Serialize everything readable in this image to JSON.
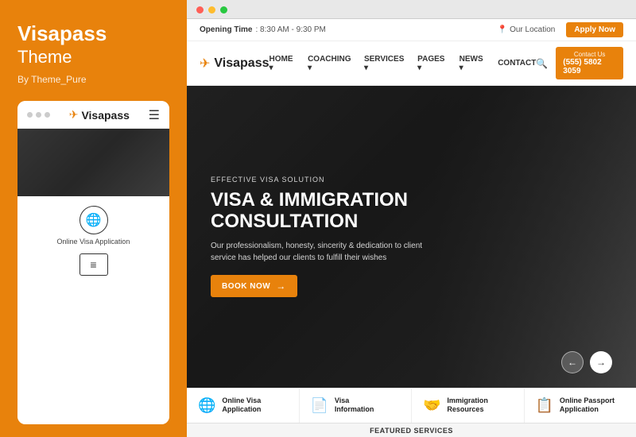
{
  "leftPanel": {
    "brandTitle": "Visapass",
    "brandSubtitle": "Theme",
    "brandAuthor": "By Theme_Pure",
    "mobile": {
      "logoText": "Visapass",
      "bottomIcons": [
        {
          "label": "Online Visa Application",
          "type": "globe"
        },
        {
          "label": "",
          "type": "doc"
        }
      ]
    }
  },
  "rightPanel": {
    "browser": {
      "dots": [
        "red",
        "yellow",
        "green"
      ]
    },
    "topbar": {
      "openingLabel": "Opening Time",
      "openingTime": ": 8:30 AM - 9:30 PM",
      "locationText": "Our Location",
      "applyBtnLabel": "Apply Now"
    },
    "nav": {
      "logoText": "Visapass",
      "links": [
        "HOME",
        "COACHING",
        "SERVICES",
        "PAGES",
        "NEWS",
        "CONTACT"
      ],
      "contactLabel": "Contact Us",
      "contactPhone": "(555) 5802 3059"
    },
    "hero": {
      "eyebrow": "EFFECTIVE VISA SOLUTION",
      "title": "VISA & IMMIGRATION CONSULTATION",
      "description": "Our professionalism, honesty, sincerity & dedication to client service has helped our clients to fulfill their wishes",
      "bookBtnLabel": "BOOK NOW",
      "arrows": [
        "←",
        "→"
      ]
    },
    "servicesBar": [
      {
        "icon": "🌐",
        "name": "Online Visa\nApplication"
      },
      {
        "icon": "📄",
        "name": "Visa\nInformation"
      },
      {
        "icon": "🤝",
        "name": "Immigration\nResources"
      },
      {
        "icon": "📋",
        "name": "Online Passport\nApplication"
      }
    ],
    "featured": "FEATURED SERVICES"
  }
}
